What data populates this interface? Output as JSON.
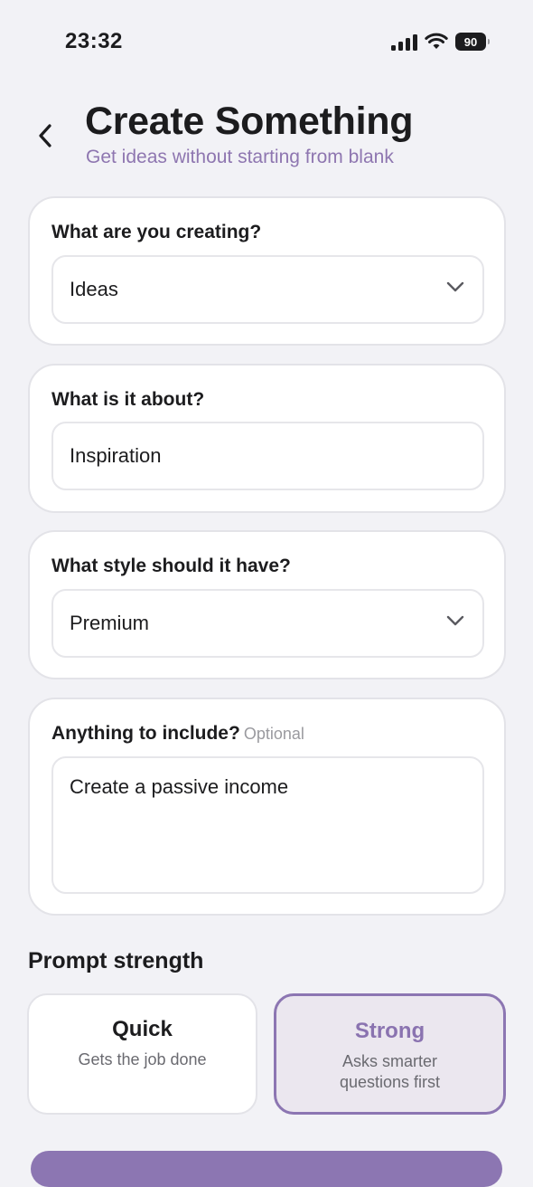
{
  "status_bar": {
    "time": "23:32",
    "battery": "90"
  },
  "header": {
    "title": "Create Something",
    "subtitle": "Get ideas without starting from blank"
  },
  "form": {
    "creating": {
      "label": "What are you creating?",
      "value": "Ideas"
    },
    "about": {
      "label": "What is it about?",
      "value": "Inspiration"
    },
    "style": {
      "label": "What style should it have?",
      "value": "Premium"
    },
    "include": {
      "label": "Anything to include?",
      "optional": "Optional",
      "value": "Create a passive income"
    }
  },
  "prompt_strength": {
    "title": "Prompt strength",
    "options": [
      {
        "title": "Quick",
        "description": "Gets the job done",
        "selected": false
      },
      {
        "title": "Strong",
        "description": "Asks smarter questions first",
        "selected": true
      }
    ]
  },
  "colors": {
    "accent": "#8c76b2",
    "background": "#f2f2f6"
  },
  "icons": {
    "back": "chevron-left-icon",
    "dropdown": "chevron-down-icon"
  }
}
